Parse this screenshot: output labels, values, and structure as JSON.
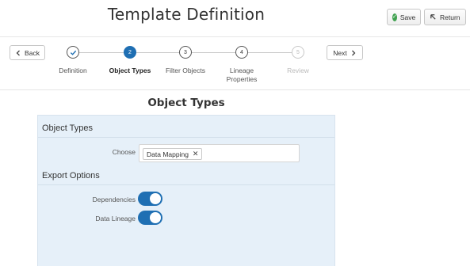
{
  "header": {
    "title": "Template Definition",
    "save_label": "Save",
    "return_label": "Return",
    "save_icon": "check-circle-icon",
    "return_icon": "return-arrow-icon"
  },
  "wizard": {
    "back_label": "Back",
    "next_label": "Next",
    "steps": [
      {
        "number": "",
        "label": "Definition",
        "state": "complete"
      },
      {
        "number": "2",
        "label": "Object Types",
        "state": "current"
      },
      {
        "number": "3",
        "label": "Filter Objects",
        "state": "pending"
      },
      {
        "number": "4",
        "label": "Lineage Properties",
        "state": "pending"
      },
      {
        "number": "5",
        "label": "Review",
        "state": "disabled"
      }
    ]
  },
  "main": {
    "section_title": "Object Types",
    "object_types_region": {
      "title": "Object Types",
      "choose_label": "Choose",
      "selected_chips": [
        "Data Mapping"
      ]
    },
    "export_options_region": {
      "title": "Export Options",
      "dependencies_label": "Dependencies",
      "dependencies_on": true,
      "data_lineage_label": "Data Lineage",
      "data_lineage_on": true
    }
  },
  "colors": {
    "accent": "#1f6fb3",
    "panel_bg": "#e6f0f9",
    "save_icon": "#3fa14f"
  }
}
